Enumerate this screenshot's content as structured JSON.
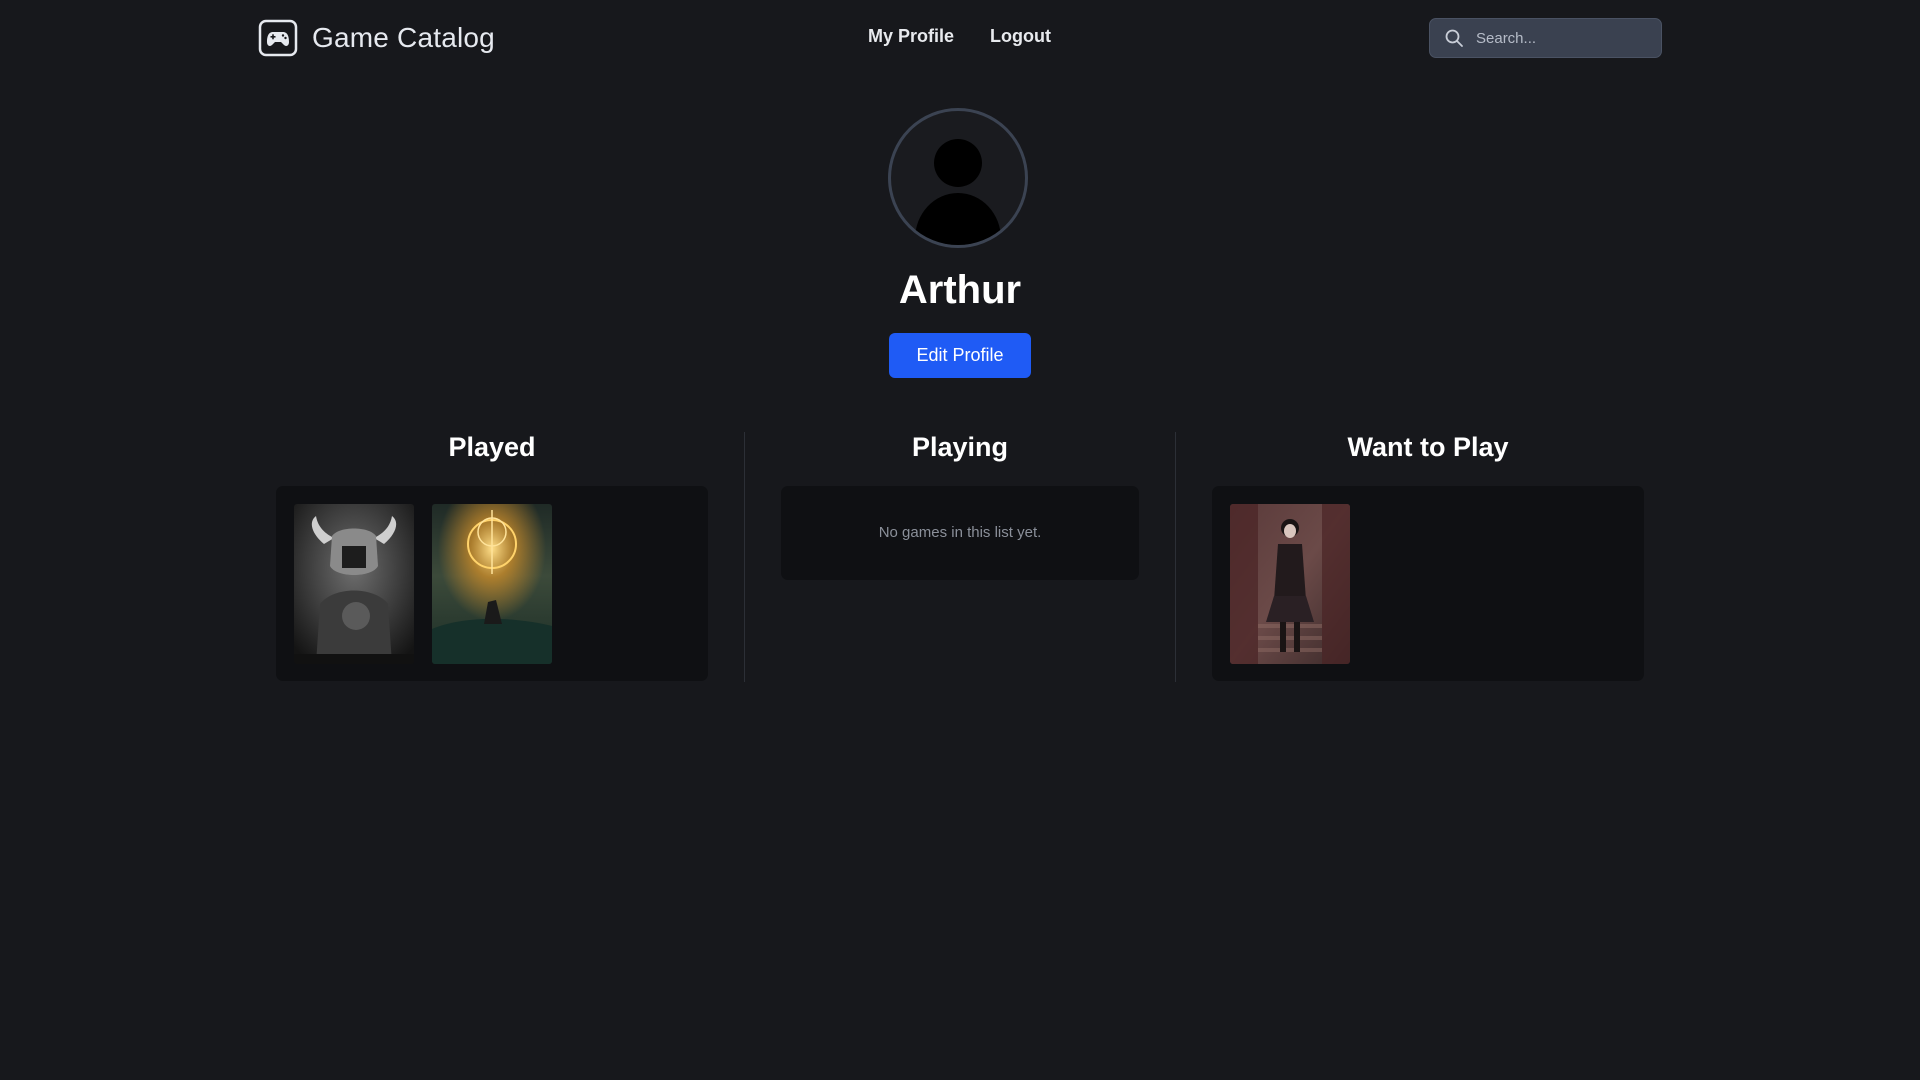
{
  "header": {
    "brand_title": "Game Catalog",
    "brand_icon": "gamepad-icon",
    "nav": [
      {
        "label": "My Profile"
      },
      {
        "label": "Logout"
      }
    ],
    "search": {
      "placeholder": "Search...",
      "value": "",
      "icon": "search-icon"
    }
  },
  "profile": {
    "avatar_icon": "user-silhouette-icon",
    "username": "Arthur",
    "edit_label": "Edit Profile"
  },
  "lists": [
    {
      "title": "Played",
      "games": [
        {
          "cover": "armored-warrior-cover"
        },
        {
          "cover": "golden-ring-cover"
        }
      ]
    },
    {
      "title": "Playing",
      "games": [],
      "empty_text": "No games in this list yet."
    },
    {
      "title": "Want to Play",
      "games": [
        {
          "cover": "girl-on-stairs-cover"
        }
      ]
    }
  ],
  "colors": {
    "background": "#17181c",
    "panel": "#0f1013",
    "accent": "#1f5bf5",
    "search_bg": "#3a4150"
  }
}
